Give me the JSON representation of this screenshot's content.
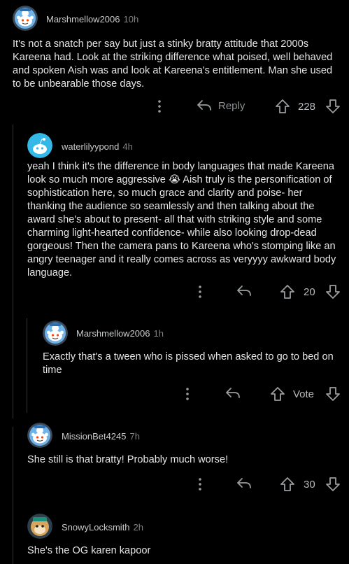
{
  "comments": [
    {
      "username": "Marshmellow2006",
      "time": "10h",
      "body": "It's not a snatch per say but just a stinky bratty attitude that 2000s Kareena had. Look at the striking difference what poised, well behaved and spoken Aish was and look at Kareena's entitlement. Man she used to be unbearable those days.",
      "reply_label": "Reply",
      "votes": "228",
      "avatar_icon": "snoo-avatar-icon"
    },
    {
      "username": "waterlilyypond",
      "time": "4h",
      "body": "yeah I think it's the difference in body languages that made Kareena look so much more aggressive 😭 Aish truly is the personification of sophistication here, so much grace and clarity and poise- her thanking the audience so seamlessly and then talking about the award she's about to present- all that with striking style and some charming light-hearted confidence- while also looking drop-dead gorgeous! Then the camera pans to Kareena who's stomping like an angry teenager and it really comes across as veryyyy awkward body language.",
      "votes": "20",
      "avatar_icon": "default-blue-avatar-icon"
    },
    {
      "username": "Marshmellow2006",
      "time": "1h",
      "body": "Exactly that's a tween who is pissed when asked to go to bed on time",
      "votes": "Vote",
      "avatar_icon": "snoo-avatar-icon"
    },
    {
      "username": "MissionBet4245",
      "time": "7h",
      "body": "She still is that bratty! Probably much worse!",
      "votes": "30",
      "avatar_icon": "snoo-avatar-icon"
    },
    {
      "username": "SnowyLocksmith",
      "time": "2h",
      "body": "She's the OG karen kapoor",
      "avatar_icon": "hamster-avatar-icon"
    }
  ],
  "colors": {
    "background": "#000000",
    "text": "#e3e5e7",
    "muted": "#8e9193",
    "thread_line": "#343536"
  }
}
